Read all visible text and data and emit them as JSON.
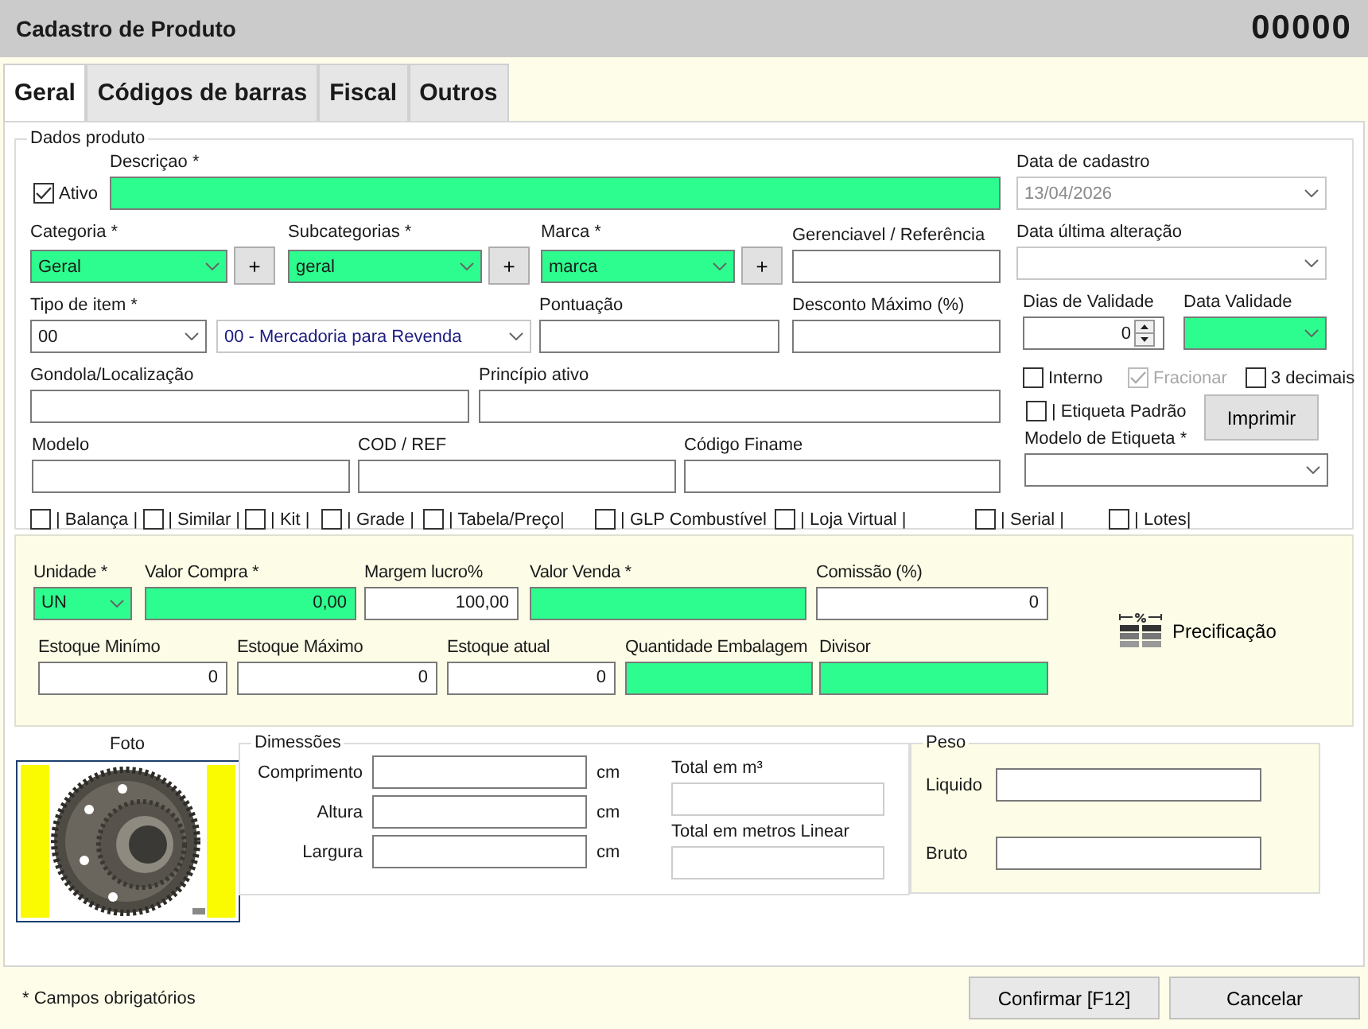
{
  "window": {
    "title": "Cadastro de Produto",
    "code": "00000"
  },
  "tabs": [
    {
      "label": "Geral",
      "selected": true
    },
    {
      "label": "Códigos de barras",
      "selected": false
    },
    {
      "label": "Fiscal",
      "selected": false
    },
    {
      "label": "Outros",
      "selected": false
    }
  ],
  "dados_produto": {
    "title": "Dados produto",
    "rows": [
      [
        {
          "kind": "checkbox",
          "label": "Ativo",
          "checked": true,
          "disabled": false
        },
        {
          "kind": "text",
          "label": "Descriçao *",
          "required": true
        }
      ],
      [
        {
          "kind": "combo",
          "label": "Categoria *",
          "value": "Geral",
          "required": true,
          "disabled": false,
          "add_button": "+"
        },
        {
          "kind": "combo",
          "label": "Subcategorias *",
          "value": "geral",
          "required": true,
          "disabled": false,
          "add_button": "+"
        },
        {
          "kind": "combo",
          "label": "Marca *",
          "value": "marca",
          "required": true,
          "disabled": false,
          "add_button": "+"
        },
        {
          "kind": "text",
          "label": "Gerenciavel / Referência",
          "required": false
        }
      ],
      [
        {
          "kind": "combo",
          "label": "Tipo de item *",
          "value": "00",
          "required": false,
          "disabled": false
        },
        {
          "kind": "combo",
          "value": "00 - Mercadoria para Revenda",
          "required": false,
          "disabled": true
        },
        {
          "kind": "text",
          "label": "Pontuação",
          "required": false
        },
        {
          "kind": "text",
          "label": "Desconto Máximo (%)",
          "required": false
        }
      ],
      [
        {
          "kind": "text",
          "label": "Gondola/Localização",
          "required": false
        },
        {
          "kind": "text",
          "label": "Princípio ativo",
          "required": false
        }
      ],
      [
        {
          "kind": "text",
          "label": "Modelo",
          "required": false
        },
        {
          "kind": "text",
          "label": "COD / REF",
          "required": false
        },
        {
          "kind": "text",
          "label": "Código Finame",
          "required": false
        }
      ]
    ],
    "side": [
      [
        {
          "kind": "combo",
          "label": "Data de cadastro",
          "value": "13/04/2026",
          "required": false,
          "disabled": true
        }
      ],
      [
        {
          "kind": "combo",
          "label": "Data última alteração",
          "required": false,
          "disabled": true
        }
      ],
      [
        {
          "kind": "spin",
          "label": "Dias de Validade",
          "value": "0"
        },
        {
          "kind": "combo",
          "label": "Data Validade",
          "required": true,
          "disabled": false
        }
      ],
      [
        {
          "kind": "checkbox",
          "label": "Interno",
          "checked": false,
          "disabled": false
        },
        {
          "kind": "checkbox",
          "label": "Fracionar",
          "checked": true,
          "disabled": true
        },
        {
          "kind": "checkbox",
          "label": "3 decimais",
          "checked": false,
          "disabled": false
        }
      ],
      [
        {
          "kind": "checkbox",
          "label": "| Etiqueta Padrão",
          "checked": false,
          "disabled": false
        },
        {
          "kind": "button",
          "label": "Imprimir"
        }
      ],
      [
        {
          "kind": "combo",
          "label": "Modelo de Etiqueta *",
          "required": false,
          "disabled": false
        }
      ]
    ],
    "flags": [
      {
        "label": "| Balança |",
        "checked": false
      },
      {
        "label": "| Similar |",
        "checked": false
      },
      {
        "label": "| Kit |",
        "checked": false
      },
      {
        "label": "| Grade |",
        "checked": false
      },
      {
        "label": "| Tabela/Preço|",
        "checked": false
      },
      {
        "label": "| GLP Combustível",
        "checked": false
      },
      {
        "label": "| Loja Virtual |",
        "checked": false
      },
      {
        "label": "| Serial |",
        "checked": false
      },
      {
        "label": "| Lotes|",
        "checked": false
      }
    ]
  },
  "precos": {
    "valores": [
      {
        "kind": "combo",
        "label": "Unidade *",
        "value": "UN",
        "required": true,
        "disabled": false
      },
      {
        "kind": "text",
        "label": "Valor Compra *",
        "value": "0,00",
        "required": true
      },
      {
        "kind": "text",
        "label": "Margem lucro%",
        "value": "100,00",
        "required": false
      },
      {
        "kind": "text",
        "label": "Valor Venda *",
        "required": true
      },
      {
        "kind": "text",
        "label": "Comissão (%)",
        "value": "0",
        "required": false
      }
    ],
    "estoque": [
      {
        "kind": "text",
        "label": "Estoque Minímo",
        "value": "0",
        "required": false
      },
      {
        "kind": "text",
        "label": "Estoque Máximo",
        "value": "0",
        "required": false
      },
      {
        "kind": "text",
        "label": "Estoque atual",
        "value": "0",
        "required": false
      },
      {
        "kind": "text",
        "label": "Quantidade Embalagem",
        "required": true
      },
      {
        "kind": "text",
        "label": "Divisor",
        "required": true
      }
    ],
    "precificacao": {
      "label": "Precificação"
    }
  },
  "foto": {
    "label": "Foto",
    "kind": "picture"
  },
  "dimensoes": {
    "title": "Dimessões",
    "rows": [
      {
        "label": "Comprimento",
        "unit": "cm"
      },
      {
        "label": "Altura",
        "unit": "cm"
      },
      {
        "label": "Largura",
        "unit": "cm"
      }
    ],
    "totals": [
      {
        "label": "Total em m³",
        "disabled": true
      },
      {
        "label": "Total em metros Linear",
        "disabled": true
      }
    ]
  },
  "peso": {
    "title": "Peso",
    "rows": [
      {
        "label": "Liquido"
      },
      {
        "label": "Bruto"
      }
    ]
  },
  "footer": {
    "note": "* Campos obrigatórios",
    "buttons": [
      "Confirmar [F12]",
      "Cancelar"
    ]
  }
}
